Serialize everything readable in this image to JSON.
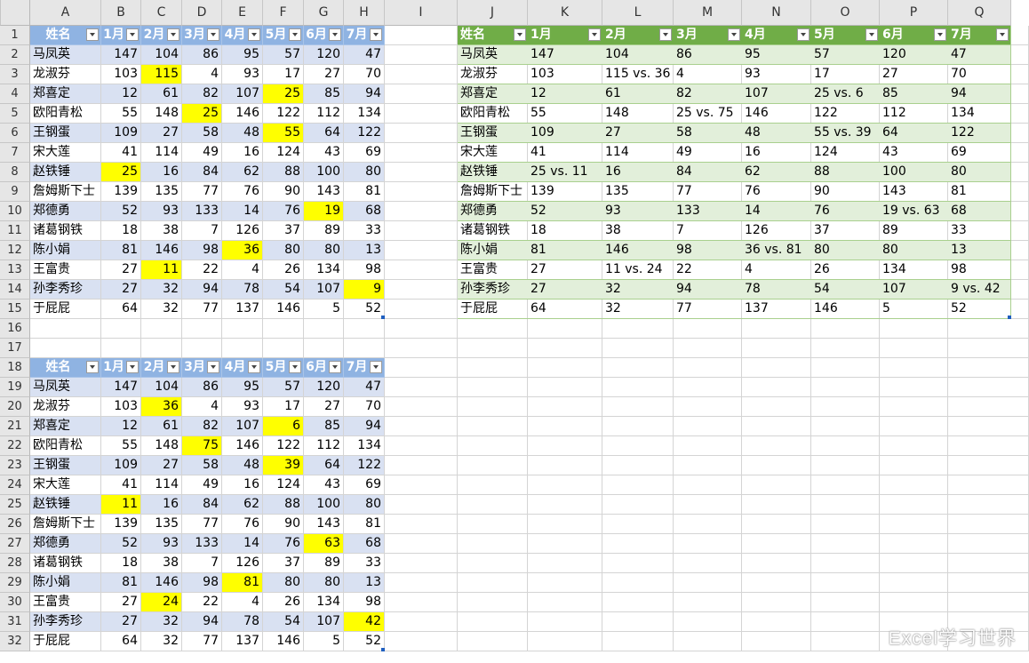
{
  "columns": [
    "A",
    "B",
    "C",
    "D",
    "E",
    "F",
    "G",
    "H",
    "I",
    "J",
    "K",
    "L",
    "M",
    "N",
    "O",
    "P",
    "Q"
  ],
  "rows": [
    1,
    2,
    3,
    4,
    5,
    6,
    7,
    8,
    9,
    10,
    11,
    12,
    13,
    14,
    15,
    16,
    17,
    18,
    19,
    20,
    21,
    22,
    23,
    24,
    25,
    26,
    27,
    28,
    29,
    30,
    31,
    32
  ],
  "table1": {
    "headers": [
      "姓名",
      "1月",
      "2月",
      "3月",
      "4月",
      "5月",
      "6月",
      "7月"
    ],
    "rows": [
      [
        "马凤英",
        147,
        104,
        86,
        95,
        57,
        120,
        47
      ],
      [
        "龙淑芬",
        103,
        115,
        4,
        93,
        17,
        27,
        70
      ],
      [
        "郑喜定",
        12,
        61,
        82,
        107,
        25,
        85,
        94
      ],
      [
        "欧阳青松",
        55,
        148,
        25,
        146,
        122,
        112,
        134
      ],
      [
        "王钢蛋",
        109,
        27,
        58,
        48,
        55,
        64,
        122
      ],
      [
        "宋大莲",
        41,
        114,
        49,
        16,
        124,
        43,
        69
      ],
      [
        "赵铁锤",
        25,
        16,
        84,
        62,
        88,
        100,
        80
      ],
      [
        "詹姆斯下士",
        139,
        135,
        77,
        76,
        90,
        143,
        81
      ],
      [
        "郑德勇",
        52,
        93,
        133,
        14,
        76,
        19,
        68
      ],
      [
        "诸葛钢铁",
        18,
        38,
        7,
        126,
        37,
        89,
        33
      ],
      [
        "陈小娟",
        81,
        146,
        98,
        36,
        80,
        80,
        13
      ],
      [
        "王富贵",
        27,
        11,
        22,
        4,
        26,
        134,
        98
      ],
      [
        "孙李秀珍",
        27,
        32,
        94,
        78,
        54,
        107,
        9
      ],
      [
        "于屁屁",
        64,
        32,
        77,
        137,
        146,
        5,
        52
      ]
    ],
    "highlights": [
      [
        1,
        2
      ],
      [
        2,
        5
      ],
      [
        3,
        3
      ],
      [
        4,
        5
      ],
      [
        6,
        1
      ],
      [
        8,
        6
      ],
      [
        10,
        4
      ],
      [
        11,
        2
      ],
      [
        12,
        7
      ]
    ]
  },
  "table2": {
    "headers": [
      "姓名",
      "1月",
      "2月",
      "3月",
      "4月",
      "5月",
      "6月",
      "7月"
    ],
    "rows": [
      [
        "马凤英",
        147,
        104,
        86,
        95,
        57,
        120,
        47
      ],
      [
        "龙淑芬",
        103,
        36,
        4,
        93,
        17,
        27,
        70
      ],
      [
        "郑喜定",
        12,
        61,
        82,
        107,
        6,
        85,
        94
      ],
      [
        "欧阳青松",
        55,
        148,
        75,
        146,
        122,
        112,
        134
      ],
      [
        "王钢蛋",
        109,
        27,
        58,
        48,
        39,
        64,
        122
      ],
      [
        "宋大莲",
        41,
        114,
        49,
        16,
        124,
        43,
        69
      ],
      [
        "赵铁锤",
        11,
        16,
        84,
        62,
        88,
        100,
        80
      ],
      [
        "詹姆斯下士",
        139,
        135,
        77,
        76,
        90,
        143,
        81
      ],
      [
        "郑德勇",
        52,
        93,
        133,
        14,
        76,
        63,
        68
      ],
      [
        "诸葛钢铁",
        18,
        38,
        7,
        126,
        37,
        89,
        33
      ],
      [
        "陈小娟",
        81,
        146,
        98,
        81,
        80,
        80,
        13
      ],
      [
        "王富贵",
        27,
        24,
        22,
        4,
        26,
        134,
        98
      ],
      [
        "孙李秀珍",
        27,
        32,
        94,
        78,
        54,
        107,
        42
      ],
      [
        "于屁屁",
        64,
        32,
        77,
        137,
        146,
        5,
        52
      ]
    ],
    "highlights": [
      [
        1,
        2
      ],
      [
        2,
        5
      ],
      [
        3,
        3
      ],
      [
        4,
        5
      ],
      [
        6,
        1
      ],
      [
        8,
        6
      ],
      [
        10,
        4
      ],
      [
        11,
        2
      ],
      [
        12,
        7
      ]
    ]
  },
  "table3": {
    "headers": [
      "姓名",
      "1月",
      "2月",
      "3月",
      "4月",
      "5月",
      "6月",
      "7月"
    ],
    "rows": [
      [
        "马凤英",
        "147",
        "104",
        "86",
        "95",
        "57",
        "120",
        "47"
      ],
      [
        "龙淑芬",
        "103",
        "115 vs. 36",
        "4",
        "93",
        "17",
        "27",
        "70"
      ],
      [
        "郑喜定",
        "12",
        "61",
        "82",
        "107",
        "25 vs. 6",
        "85",
        "94"
      ],
      [
        "欧阳青松",
        "55",
        "148",
        "25 vs. 75",
        "146",
        "122",
        "112",
        "134"
      ],
      [
        "王钢蛋",
        "109",
        "27",
        "58",
        "48",
        "55 vs. 39",
        "64",
        "122"
      ],
      [
        "宋大莲",
        "41",
        "114",
        "49",
        "16",
        "124",
        "43",
        "69"
      ],
      [
        "赵铁锤",
        "25 vs. 11",
        "16",
        "84",
        "62",
        "88",
        "100",
        "80"
      ],
      [
        "詹姆斯下士",
        "139",
        "135",
        "77",
        "76",
        "90",
        "143",
        "81"
      ],
      [
        "郑德勇",
        "52",
        "93",
        "133",
        "14",
        "76",
        "19 vs. 63",
        "68"
      ],
      [
        "诸葛钢铁",
        "18",
        "38",
        "7",
        "126",
        "37",
        "89",
        "33"
      ],
      [
        "陈小娟",
        "81",
        "146",
        "98",
        "36 vs. 81",
        "80",
        "80",
        "13"
      ],
      [
        "王富贵",
        "27",
        "11 vs. 24",
        "22",
        "4",
        "26",
        "134",
        "98"
      ],
      [
        "孙李秀珍",
        "27",
        "32",
        "94",
        "78",
        "54",
        "107",
        "9 vs. 42"
      ],
      [
        "于屁屁",
        "64",
        "32",
        "77",
        "137",
        "146",
        "5",
        "52"
      ]
    ]
  },
  "watermark": "Excel学习世界",
  "colors": {
    "blue_header": "#8fb3e2",
    "blue_band": "#d9e1f2",
    "green_header": "#70ad47",
    "green_band": "#e2efda",
    "highlight": "#ffff00"
  }
}
